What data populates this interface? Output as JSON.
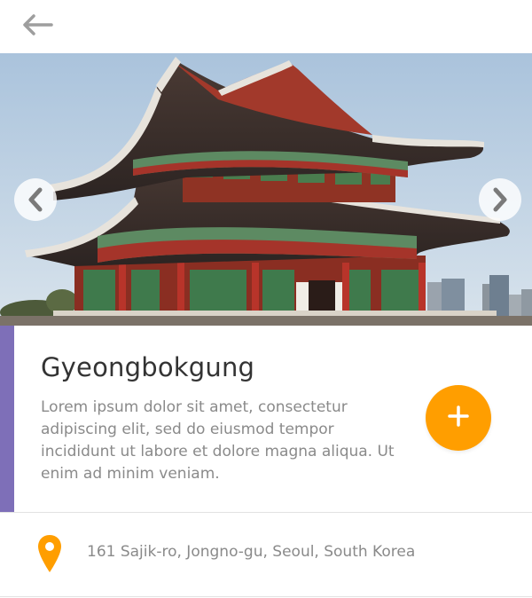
{
  "header": {
    "back_icon": "arrow-left-icon"
  },
  "hero": {
    "image": "photo of Gyeongbokgung palace pavilion against blue sky",
    "prev_icon": "chevron-left-icon",
    "next_icon": "chevron-right-icon"
  },
  "place": {
    "title": "Gyeongbokgung",
    "description": "Lorem ipsum dolor sit amet, consectetur adipiscing elit, sed do eiusmod tempor incididunt ut labore et dolore magna aliqua. Ut enim ad minim veniam.",
    "add_icon": "plus-icon"
  },
  "location": {
    "pin_icon": "map-pin-icon",
    "address": "161 Sajik-ro, Jongno-gu, Seoul, South Korea"
  },
  "colors": {
    "accent": "#7e6fb8",
    "fab": "#ff9e00",
    "pin": "#ff9e00",
    "text_primary": "#333333",
    "text_secondary": "#8a8a8a",
    "back_icon": "#9e9e9e"
  }
}
